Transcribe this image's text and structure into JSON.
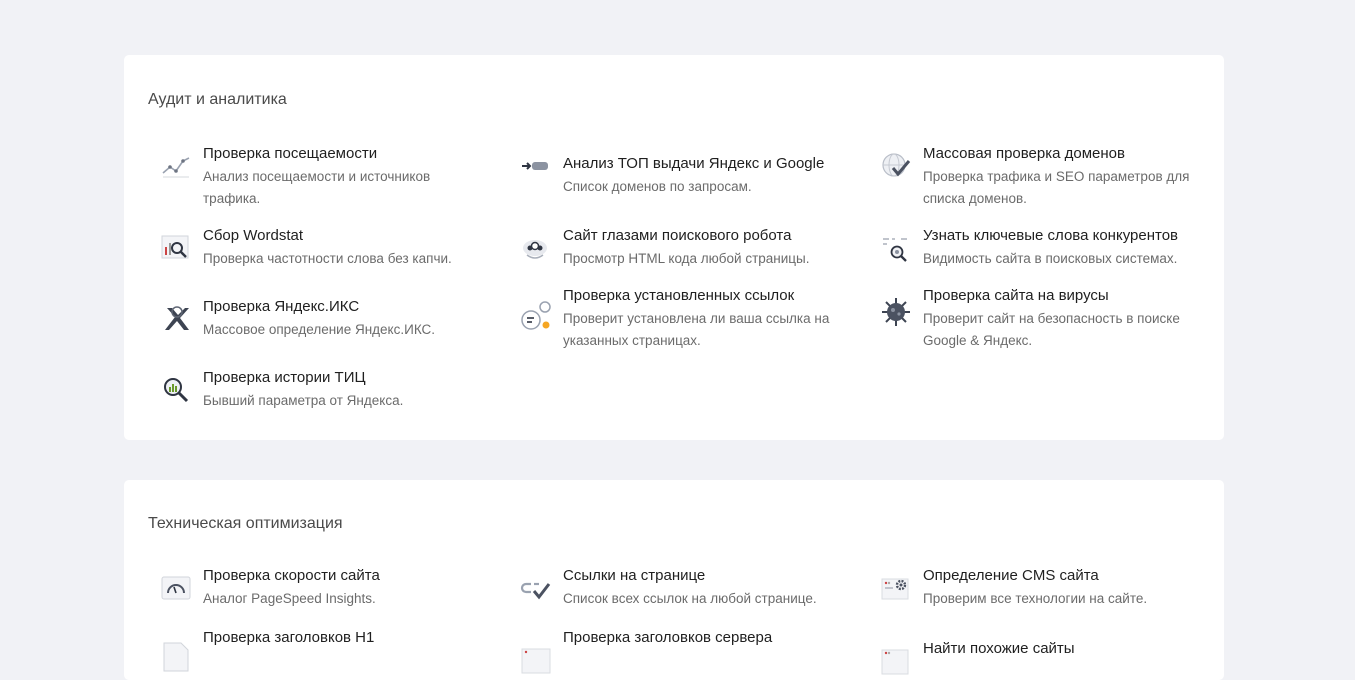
{
  "sections": [
    {
      "title": "Аудит и аналитика",
      "tools": [
        {
          "title": "Проверка посещаемости",
          "desc": "Анализ посещаемости и источников трафика.",
          "icon": "traffic-chart-icon"
        },
        {
          "title": "Анализ ТОП выдачи Яндекс и Google",
          "desc": "Список доменов по запросам.",
          "icon": "serp-arrow-icon"
        },
        {
          "title": "Массовая проверка доменов",
          "desc": "Проверка трафика и SEO параметров для списка доменов.",
          "icon": "globe-check-icon"
        },
        {
          "title": "Сбор Wordstat",
          "desc": "Проверка частотности слова без капчи.",
          "icon": "wordstat-magnifier-icon"
        },
        {
          "title": "Сайт глазами поискового робота",
          "desc": "Просмотр HTML кода любой страницы.",
          "icon": "robot-icon"
        },
        {
          "title": "Узнать ключевые слова конкурентов",
          "desc": "Видимость сайта в поисковых системах.",
          "icon": "keywords-search-icon"
        },
        {
          "title": "Проверка Яндекс.ИКС",
          "desc": "Массовое определение Яндекс.ИКС.",
          "icon": "yandex-x-icon"
        },
        {
          "title": "Проверка установленных ссылок",
          "desc": "Проверит установлена ли ваша ссылка на указанных страницах.",
          "icon": "links-bubbles-icon"
        },
        {
          "title": "Проверка сайта на вирусы",
          "desc": "Проверит сайт на безопасность в поиске Google & Яндекс.",
          "icon": "virus-icon"
        },
        {
          "title": "Проверка истории ТИЦ",
          "desc": "Бывший параметра от Яндекса.",
          "icon": "history-magnifier-icon"
        }
      ]
    },
    {
      "title": "Техническая оптимизация",
      "tools": [
        {
          "title": "Проверка скорости сайта",
          "desc": "Аналог PageSpeed Insights.",
          "icon": "speedometer-icon"
        },
        {
          "title": "Ссылки на странице",
          "desc": "Список всех ссылок на любой странице.",
          "icon": "link-check-icon"
        },
        {
          "title": "Определение CMS сайта",
          "desc": "Проверим все технологии на сайте.",
          "icon": "cms-gear-icon"
        },
        {
          "title": "Проверка заголовков H1",
          "desc": "",
          "icon": "h1-document-icon"
        },
        {
          "title": "Проверка заголовков сервера",
          "desc": "",
          "icon": "server-headers-icon"
        },
        {
          "title": "Найти похожие сайты",
          "desc": "",
          "icon": "similar-sites-icon"
        }
      ]
    }
  ]
}
